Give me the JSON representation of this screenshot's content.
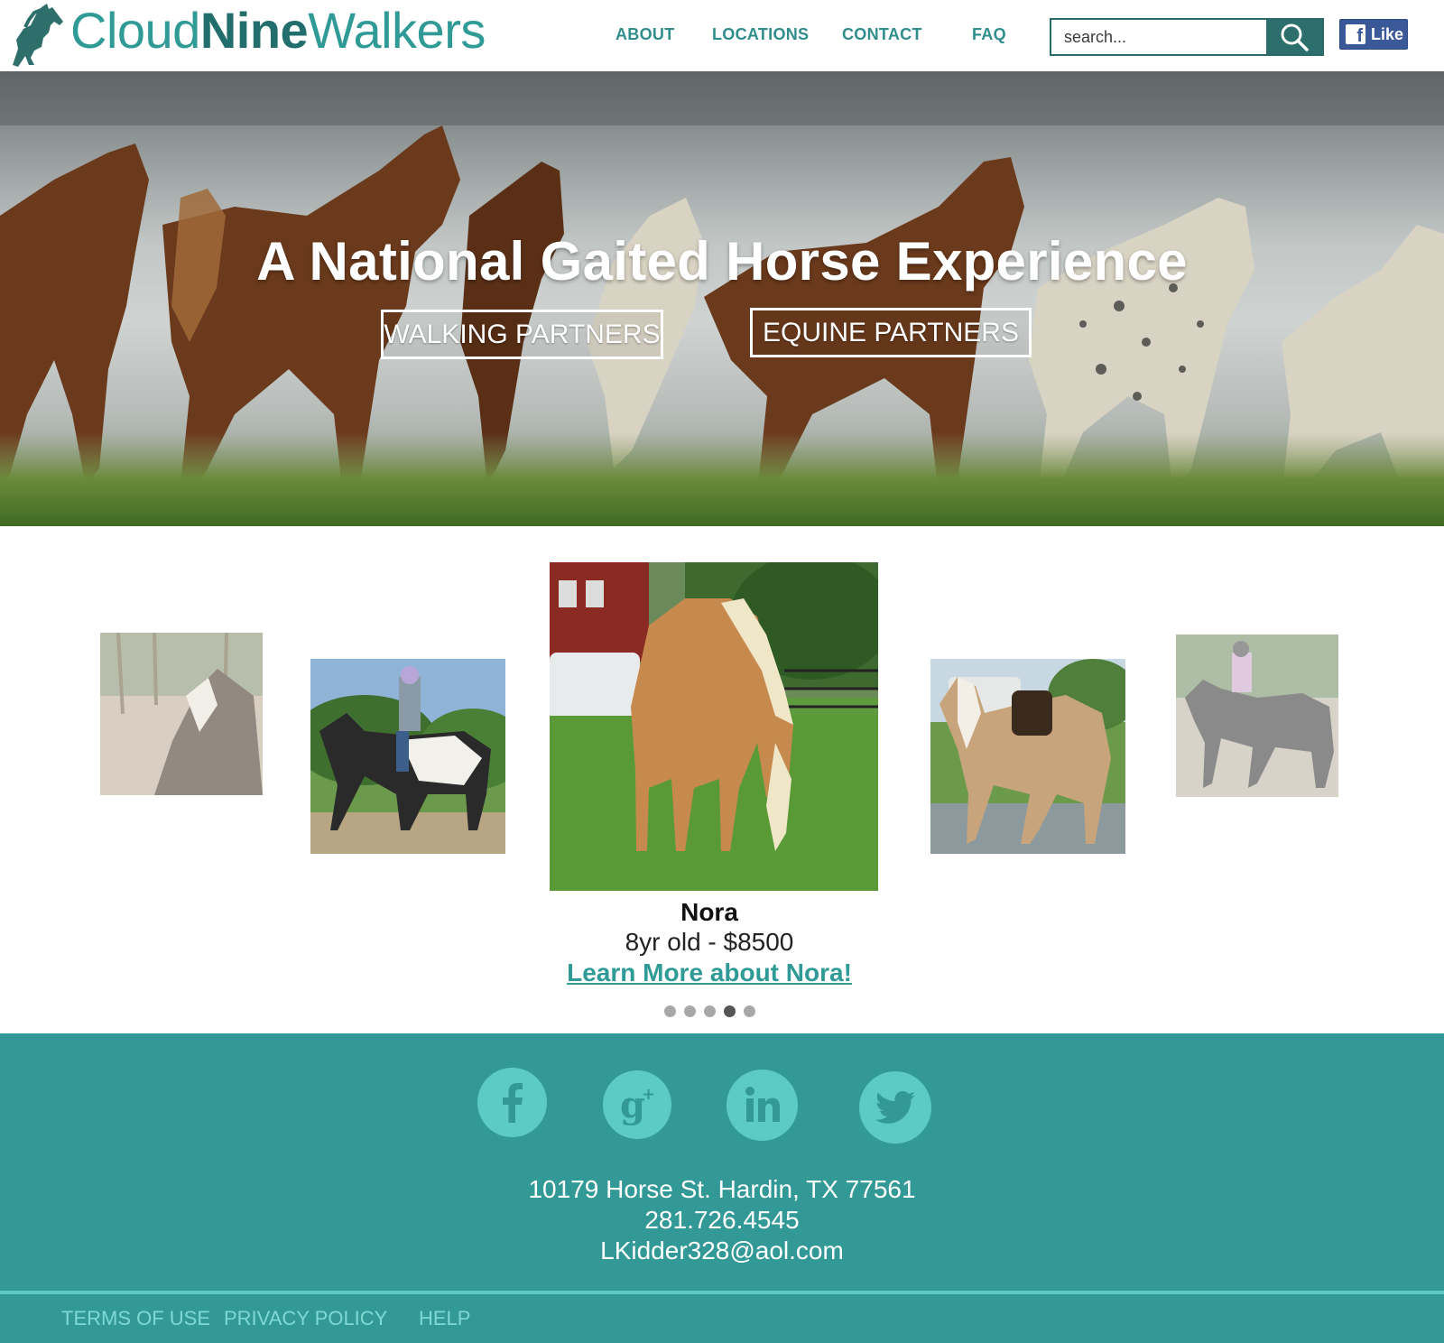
{
  "brand": {
    "part1": "Cloud",
    "part2": "Nine",
    "part3": "Walkers",
    "primary_color": "#2f9a96",
    "dark_color": "#226e6c"
  },
  "nav": {
    "about": "ABOUT",
    "locations": "LOCATIONS",
    "contact": "CONTACT",
    "faq": "FAQ"
  },
  "search": {
    "placeholder": "search..."
  },
  "facebook": {
    "like_label": "Like"
  },
  "hero": {
    "title": "A National Gaited Horse Experience",
    "walking_partners": "WALKING PARTNERS",
    "equine_partners": "EQUINE PARTNERS"
  },
  "carousel": {
    "featured": {
      "name": "Nora",
      "meta": "8yr old - $8500",
      "link": "Learn More about Nora!"
    },
    "dot_count": 5,
    "active_dot": 4
  },
  "footer": {
    "background": "#329996",
    "social": [
      "facebook-icon",
      "google-plus-icon",
      "linkedin-icon",
      "twitter-icon"
    ],
    "address": "10179 Horse St. Hardin, TX 77561",
    "phone": "281.726.4545",
    "email": "LKidder328@aol.com",
    "links": {
      "terms": "TERMS OF USE",
      "privacy": "PRIVACY POLICY",
      "help": "HELP"
    }
  }
}
